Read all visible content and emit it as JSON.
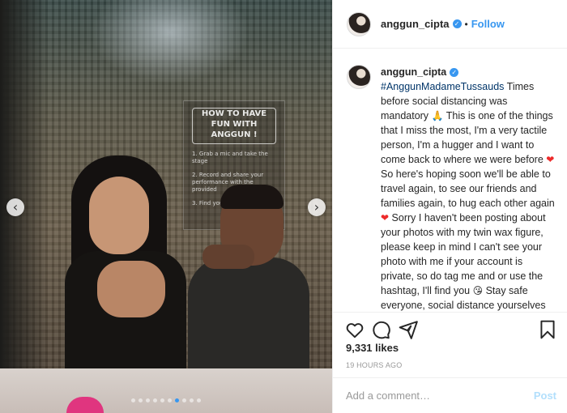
{
  "post": {
    "username": "anggun_cipta",
    "follow_label": "Follow",
    "bullet": "•",
    "verified_glyph": "✓"
  },
  "photo": {
    "sign_title": "HOW TO HAVE FUN WITH ANGGUN !",
    "sign_items": [
      "1. Grab a mic and take the stage",
      "2. Record and share your performance with the provided",
      "3. Find yours"
    ],
    "carousel_total": 10,
    "carousel_active_index": 6,
    "prev_glyph": "‹",
    "next_glyph": "›"
  },
  "caption": {
    "username": "anggun_cipta",
    "hashtag": "#AnggunMadameTussauds",
    "p1": " Times before social distancing was mandatory ",
    "emoji_pray": "🙏",
    "p2": " This is one of the things that I miss the most, I'm a very tactile person, I'm a hugger and I want to come back to where we were before ",
    "emoji_heart": "❤",
    "p3": " So here's hoping soon we'll be able to travel again, to see our friends and families again, to hug each other again ",
    "emoji_heart2": "❤",
    "p4": " Sorry I haven't been posting about your photos with my twin wax figure, please keep in mind I can't see your photo with me if your account is private, so do tag me and or use the hashtag, I'll find you ",
    "emoji_wink": "😘",
    "p5": " Stay safe everyone, social distance yourselves until all is better ",
    "emoji_tail": "🙏 ❤"
  },
  "stats": {
    "likes": "9,331 likes",
    "time": "19 HOURS AGO"
  },
  "comment": {
    "placeholder": "Add a comment…",
    "post_label": "Post"
  },
  "icons": {
    "like": "heart-outline-icon",
    "comment": "speech-bubble-icon",
    "share": "paper-plane-icon",
    "save": "bookmark-icon"
  },
  "colors": {
    "accent": "#3897f0",
    "post_disabled": "#b2dffc",
    "hashtag": "#003569"
  }
}
